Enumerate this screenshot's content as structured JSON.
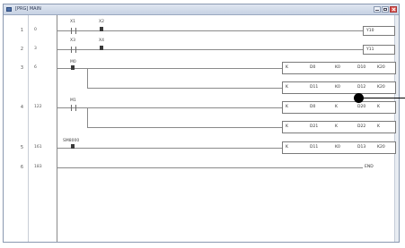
{
  "window": {
    "title": "[PRG] MAIN"
  },
  "rows": [
    {
      "num": "1",
      "step": "0"
    },
    {
      "num": "2",
      "step": "3"
    },
    {
      "num": "3",
      "step": "6"
    },
    {
      "num": "4",
      "step": "122"
    },
    {
      "num": "5",
      "step": "161"
    },
    {
      "num": "6",
      "step": "183"
    }
  ],
  "contacts": {
    "r1a": "X1",
    "r1b": "X2",
    "r2a": "X3",
    "r2b": "X4",
    "r3": "M0",
    "r4": "M1",
    "r5": "SM8000"
  },
  "coils": {
    "r1": "Y10",
    "r2": "Y11"
  },
  "fbrows": [
    [
      "K",
      "D0",
      "K0",
      "D10",
      "K20"
    ],
    [
      "K",
      "D11",
      "K0",
      "D12",
      "K20"
    ],
    [
      "K",
      "D0",
      "K",
      "D20",
      "K"
    ],
    [
      "K",
      "D21",
      "K",
      "D22",
      "K"
    ],
    [
      "K",
      "D11",
      "K0",
      "D13",
      "K20"
    ]
  ],
  "end_label": "END"
}
